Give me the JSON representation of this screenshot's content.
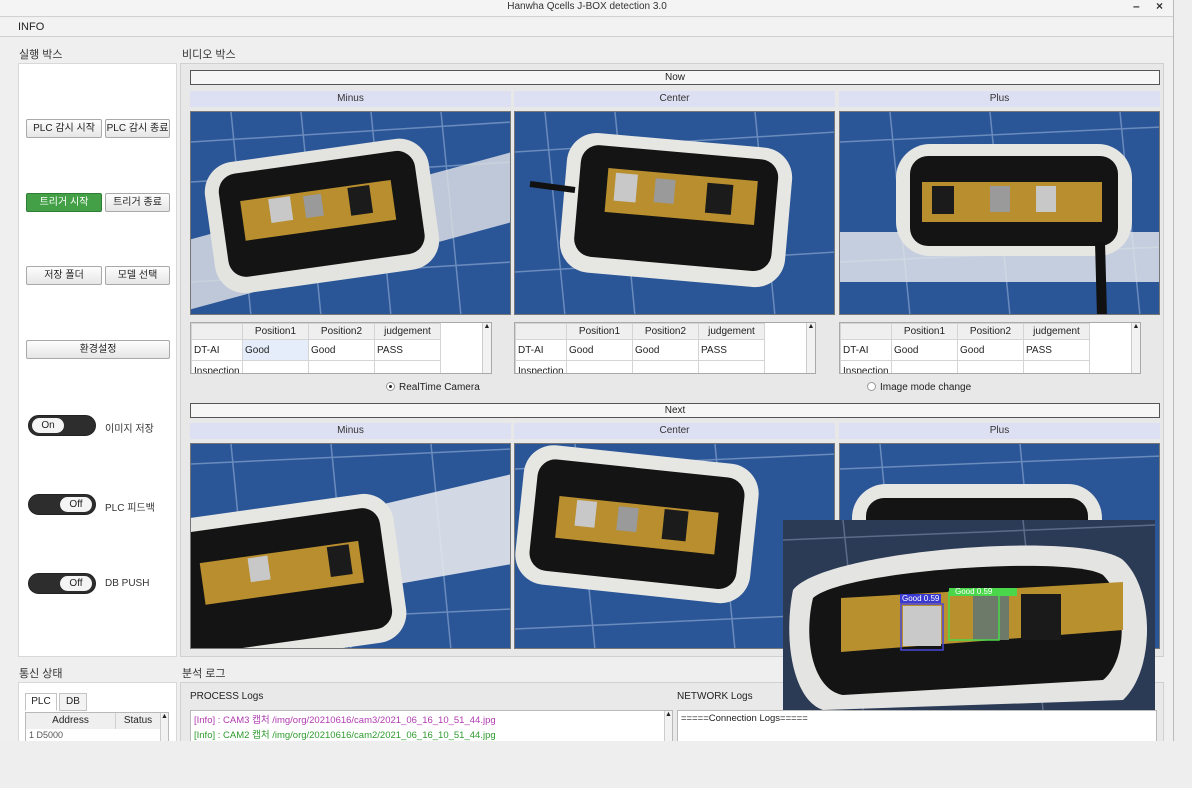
{
  "window": {
    "title": "Hanwha Qcells J-BOX detection 3.0",
    "minimize": "–",
    "close": "×"
  },
  "menu": {
    "info": "INFO"
  },
  "left_panel": {
    "label": "실행 박스",
    "plc_start": "PLC 감시 시작",
    "plc_stop": "PLC 감시 종료",
    "trigger_start": "트리거 시작",
    "trigger_stop": "트리거 종료",
    "save_folder": "저장 폴더",
    "model_select": "모델 선택",
    "settings": "환경설정",
    "toggles": [
      {
        "state": "On",
        "label": "이미지 저장"
      },
      {
        "state": "Off",
        "label": "PLC 피드백"
      },
      {
        "state": "Off",
        "label": "DB PUSH"
      }
    ]
  },
  "video": {
    "label": "비디오 박스",
    "now": "Now",
    "next": "Next",
    "positions": [
      "Minus",
      "Center",
      "Plus"
    ],
    "table_headers": [
      "Position1",
      "Position2",
      "judgement"
    ],
    "results": [
      {
        "row": "DT-AI",
        "p1": "Good",
        "p2": "Good",
        "judgement": "PASS"
      },
      {
        "row": "DT-AI",
        "p1": "Good",
        "p2": "Good",
        "judgement": "PASS"
      },
      {
        "row": "DT-AI",
        "p1": "Good",
        "p2": "Good",
        "judgement": "PASS"
      }
    ],
    "row_partial": "Inspection",
    "radio_realtime": "RealTime Camera",
    "radio_image": "Image mode change"
  },
  "status": {
    "label": "통신 상태",
    "tabs": [
      "PLC",
      "DB"
    ],
    "headers": [
      "Address",
      "Status"
    ],
    "row_partial": "1 D5000"
  },
  "logs": {
    "label": "분석 로그",
    "process_title": "PROCESS Logs",
    "process_lines": [
      "[Info] : CAM3 캡처 /img/org/20210616/cam3/2021_06_16_10_51_44.jpg",
      "[Info] : CAM2 캡처 /img/org/20210616/cam2/2021_06_16_10_51_44.jpg"
    ],
    "process_colors": [
      "#b03ab0",
      "#2e9b2e"
    ],
    "network_title": "NETWORK Logs",
    "network_lines": [
      "=====Connection Logs====="
    ]
  },
  "detection_inset": {
    "box1_label": "Good  0.59",
    "box2_label": "Good  0.59"
  }
}
